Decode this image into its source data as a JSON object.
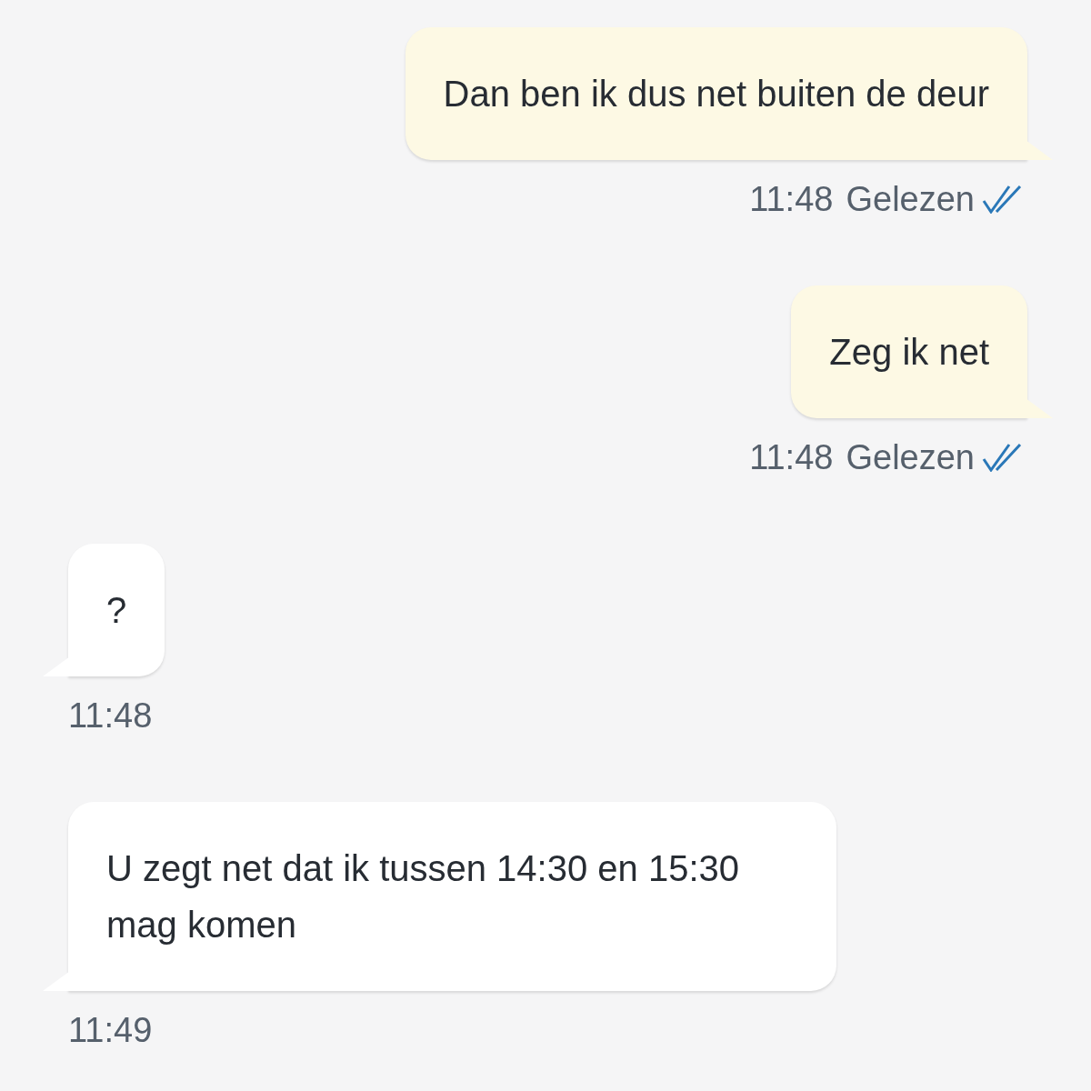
{
  "messages": [
    {
      "kind": "outgoing",
      "text": "Dan ben ik dus net buiten de deur",
      "time": "11:48",
      "status": "Gelezen",
      "read": true
    },
    {
      "kind": "outgoing",
      "text": "Zeg ik net",
      "time": "11:48",
      "status": "Gelezen",
      "read": true
    },
    {
      "kind": "incoming",
      "text": "?",
      "time": "11:48"
    },
    {
      "kind": "incoming",
      "text": "U zegt net dat ik tussen 14:30 en 15:30 mag komen",
      "time": "11:49"
    }
  ]
}
